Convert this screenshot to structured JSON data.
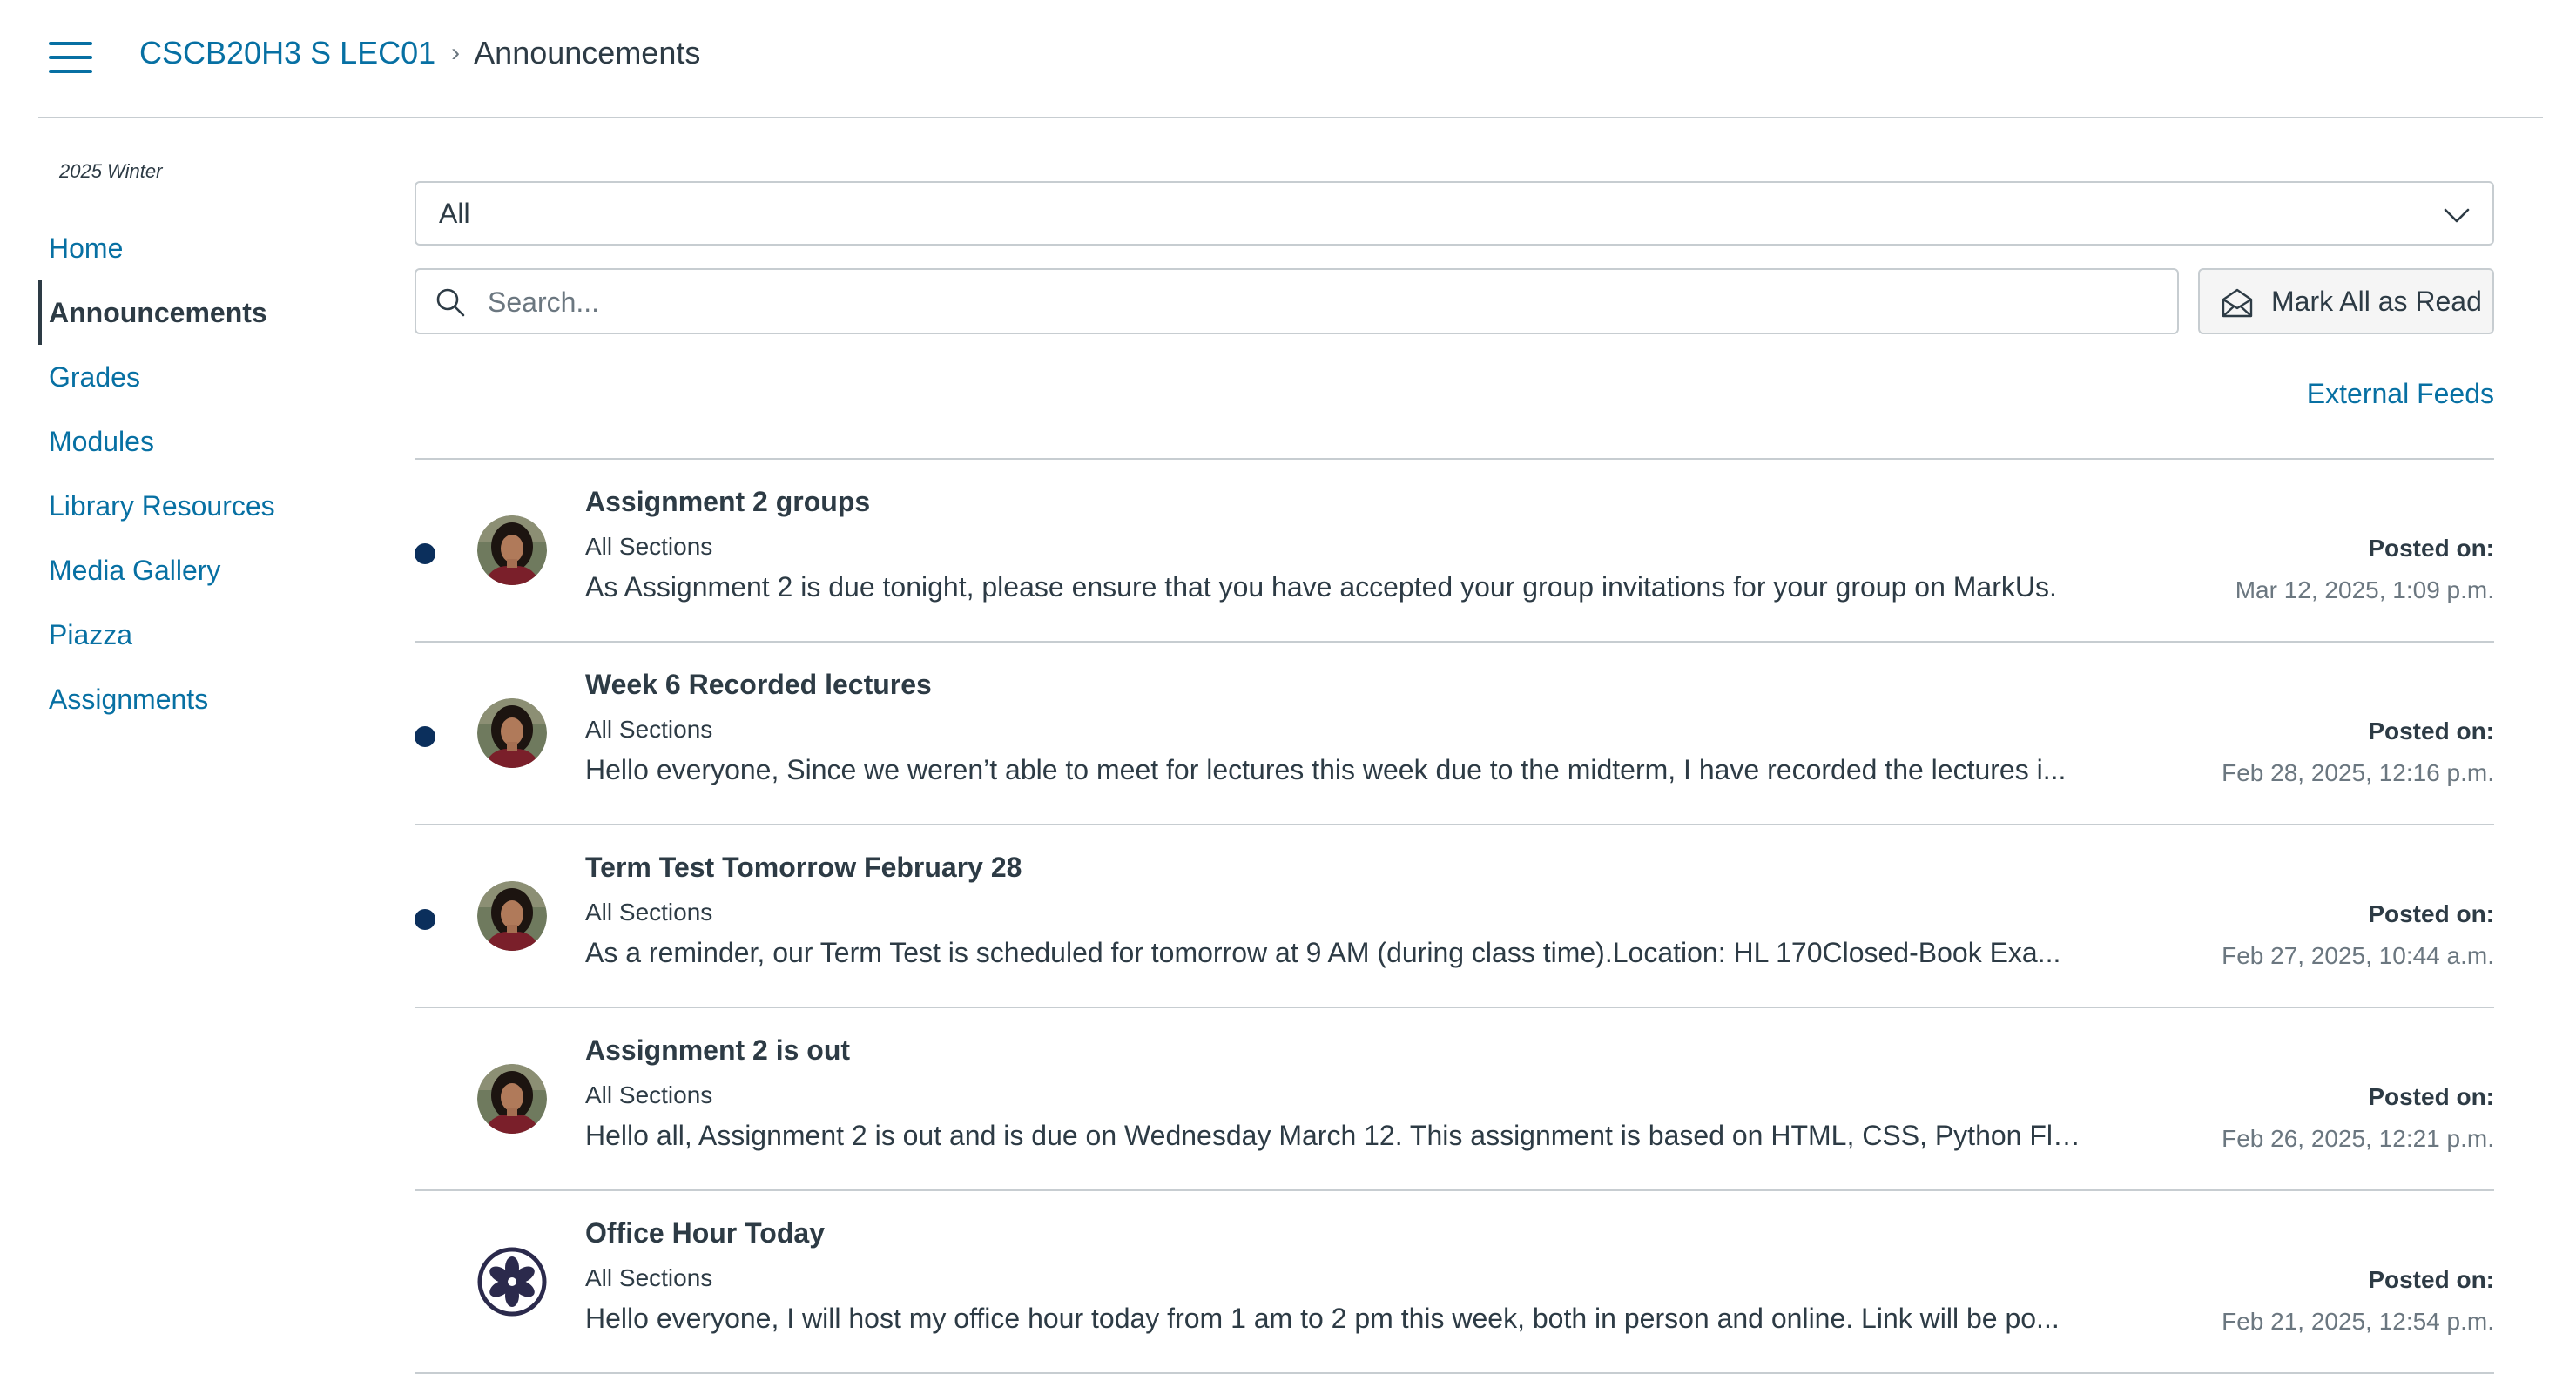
{
  "header": {
    "course_link": "CSCB20H3 S LEC01",
    "separator": "›",
    "current_page": "Announcements"
  },
  "sidebar": {
    "term": "2025 Winter",
    "items": [
      {
        "label": "Home"
      },
      {
        "label": "Announcements"
      },
      {
        "label": "Grades"
      },
      {
        "label": "Modules"
      },
      {
        "label": "Library Resources"
      },
      {
        "label": "Media Gallery"
      },
      {
        "label": "Piazza"
      },
      {
        "label": "Assignments"
      }
    ],
    "active_item": "Announcements"
  },
  "filter": {
    "selected": "All"
  },
  "search": {
    "placeholder": "Search..."
  },
  "toolbar": {
    "mark_all_label": "Mark All as Read",
    "external_feeds_label": "External Feeds"
  },
  "announcements": [
    {
      "title": "Assignment 2 groups",
      "sections": "All Sections",
      "message": "As Assignment 2 is due tonight, please ensure that you have accepted your group invitations for your group on MarkUs.",
      "posted_label": "Posted on:",
      "posted_date": "Mar 12, 2025, 1:09 p.m.",
      "unread": true,
      "avatar": "photo"
    },
    {
      "title": "Week 6 Recorded lectures",
      "sections": "All Sections",
      "message": "Hello everyone, Since we weren’t able to meet for lectures this week due to the midterm, I have recorded the lectures i...",
      "posted_label": "Posted on:",
      "posted_date": "Feb 28, 2025, 12:16 p.m.",
      "unread": true,
      "avatar": "photo"
    },
    {
      "title": "Term Test Tomorrow February 28",
      "sections": "All Sections",
      "message": "As a reminder, our Term Test is scheduled for tomorrow at 9 AM (during class time).Location: HL 170Closed-Book Exa...",
      "posted_label": "Posted on:",
      "posted_date": "Feb 27, 2025, 10:44 a.m.",
      "unread": true,
      "avatar": "photo"
    },
    {
      "title": "Assignment 2 is out",
      "sections": "All Sections",
      "message": "Hello all, Assignment 2 is out and is due on Wednesday March 12. This assignment is based on HTML, CSS, Python Fla...",
      "posted_label": "Posted on:",
      "posted_date": "Feb 26, 2025, 12:21 p.m.",
      "unread": false,
      "avatar": "photo"
    },
    {
      "title": "Office Hour Today",
      "sections": "All Sections",
      "message": "Hello everyone, I will host my office hour today from 1 am to 2 pm this week, both in person and online. Link will be po...",
      "posted_label": "Posted on:",
      "posted_date": "Feb 21, 2025, 12:54 p.m.",
      "unread": false,
      "avatar": "pinwheel-logo"
    }
  ],
  "colors": {
    "link": "#0770a3",
    "text": "#2d3b45",
    "muted": "#6b7780",
    "border": "#c7cdd1",
    "unread_dot": "#0b2f5c",
    "logo": "#2b2a4c"
  },
  "icons": {
    "menu": "hamburger-icon",
    "search": "search-icon",
    "mark_read": "envelope-open-icon",
    "dropdown": "chevron-down-icon"
  }
}
